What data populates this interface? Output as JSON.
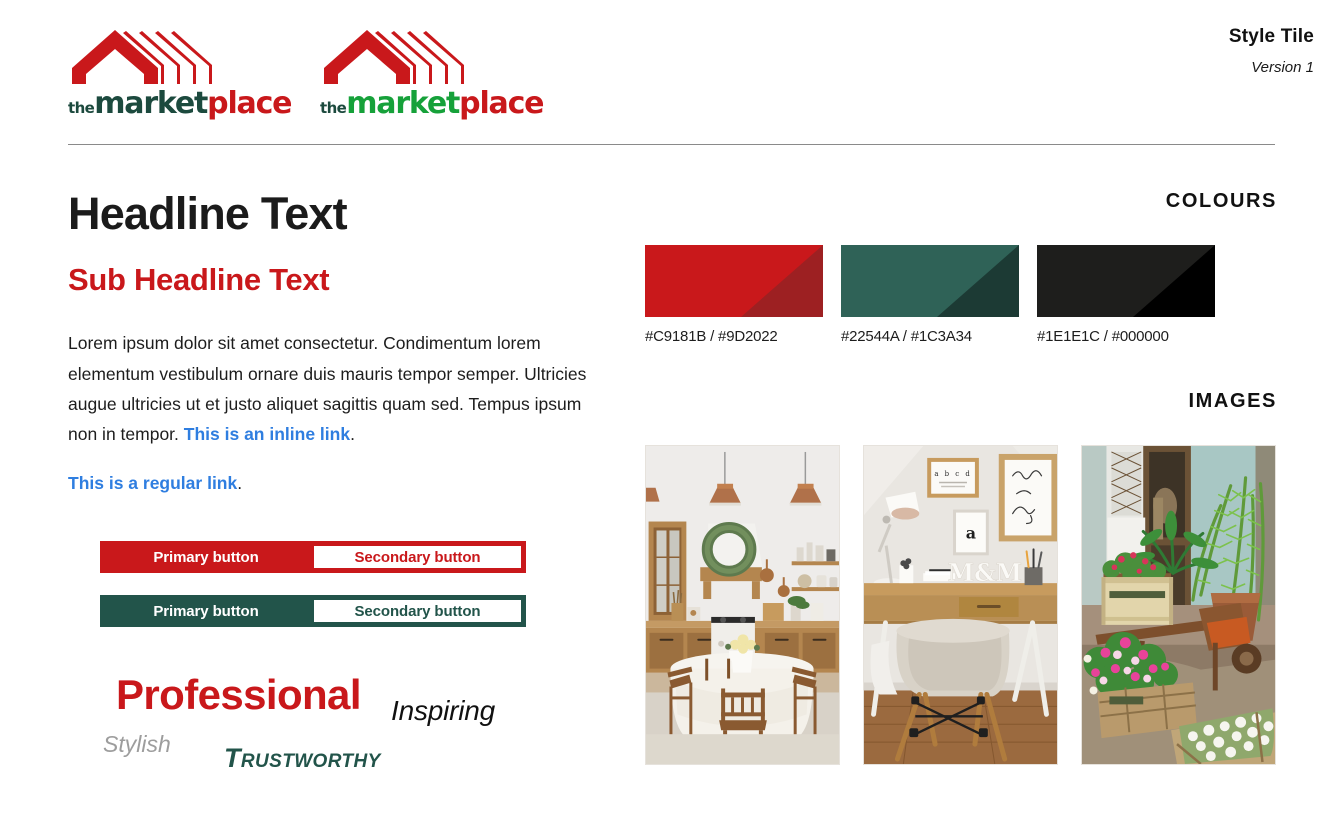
{
  "header": {
    "logos": [
      {
        "name": "logo-primary",
        "the": "the",
        "market": "market",
        "place": "place",
        "market_color": "#1C4A3E",
        "place_color": "#C9181B",
        "the_color": "#1C4A3E",
        "roof_color": "#C9181B"
      },
      {
        "name": "logo-alt",
        "the": "the",
        "market": "market",
        "place": "place",
        "market_color": "#16A13A",
        "place_color": "#C9181B",
        "the_color": "#1C4A3E",
        "roof_color": "#C9181B"
      }
    ],
    "title": "Style Tile",
    "version": "Version 1"
  },
  "left": {
    "headline": "Headline Text",
    "sub_headline": "Sub Headline Text",
    "body_text": "Lorem ipsum dolor sit amet consectetur. Condimentum lorem elementum vestibulum ornare duis mauris tempor semper. Ultricies augue ultricies ut et justo aliquet sagittis quam sed. Tempus ipsum non in tempor. ",
    "inline_link": "This is an inline link",
    "inline_link_period": ".",
    "regular_link": "This is a regular link",
    "regular_link_period": ".",
    "buttons": [
      {
        "variant": "red",
        "primary": "Primary button",
        "secondary": "Secondary button",
        "color": "#C9181B"
      },
      {
        "variant": "green",
        "primary": "Primary button",
        "secondary": "Secondary button",
        "color": "#22544A"
      }
    ],
    "adjectives": [
      {
        "text": "Professional",
        "color": "#C9181B",
        "style": "bold"
      },
      {
        "text": "Inspiring",
        "color": "#111111",
        "style": "italic"
      },
      {
        "text": "Stylish",
        "color": "#9D9D9D",
        "style": "italic-light"
      },
      {
        "text": "Trustworthy",
        "color": "#22544A",
        "style": "bold-italic-smallcaps"
      }
    ]
  },
  "right": {
    "colours_heading": "COLOURS",
    "images_heading": "IMAGES",
    "swatches": [
      {
        "name": "swatch-red",
        "light": "#C9181B",
        "dark": "#9D2022",
        "label": "#C9181B / #9D2022"
      },
      {
        "name": "swatch-green",
        "light": "#2F6257",
        "dark": "#1C3A34",
        "label": "#22544A / #1C3A34"
      },
      {
        "name": "swatch-black",
        "light": "#1E1E1C",
        "dark": "#000000",
        "label": "#1E1E1C / #000000"
      }
    ],
    "photos": [
      {
        "name": "photo-kitchen-dining",
        "alt": "Rustic kitchen with wooden cabinets, copper pendant lamps and round dining table with white tablecloth"
      },
      {
        "name": "photo-home-office",
        "alt": "Home office with wooden desk, beige moulded armchair, desk lamp and framed wall prints"
      },
      {
        "name": "photo-garden-porch",
        "alt": "Garden porch with ferns, pink flowers, wooden crates and an old wheelbarrow"
      }
    ]
  }
}
